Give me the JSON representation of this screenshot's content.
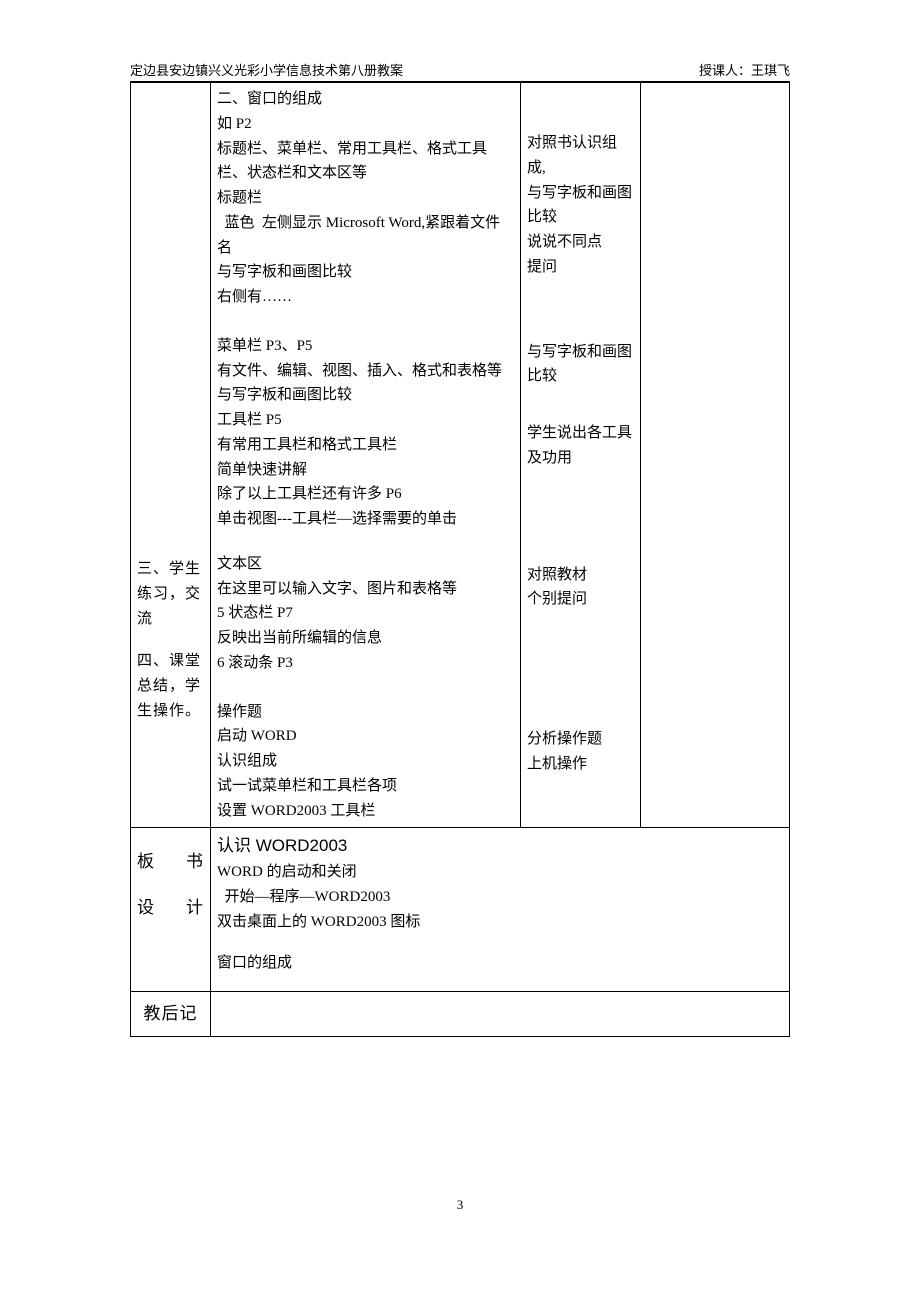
{
  "header": {
    "left": "定边县安边镇兴义光彩小学信息技术第八册教案",
    "right": "授课人：王琪飞"
  },
  "row1": {
    "col1_a": "三、学生练习，交流",
    "col1_b": "四、课堂总结，学生操作。",
    "col2_block1_l1": "二、窗口的组成",
    "col2_block1_l2": "如 P2",
    "col2_block1_l3": "标题栏、菜单栏、常用工具栏、格式工具栏、状态栏和文本区等",
    "col2_block1_l4": "标题栏",
    "col2_block1_l5": "  蓝色  左侧显示 Microsoft Word,紧跟着文件名",
    "col2_block1_l6": "与写字板和画图比较",
    "col2_block1_l7": "右侧有……",
    "col2_block2_l1": "菜单栏    P3、P5",
    "col2_block2_l2": "有文件、编辑、视图、插入、格式和表格等",
    "col2_block2_l3": "与写字板和画图比较",
    "col2_block2_l4": "工具栏    P5",
    "col2_block2_l5": "有常用工具栏和格式工具栏",
    "col2_block2_l6": "简单快速讲解",
    "col2_block2_l7": "除了以上工具栏还有许多 P6",
    "col2_block2_l8": "单击视图---工具栏—选择需要的单击",
    "col2_block3_l1": "文本区",
    "col2_block3_l2": "在这里可以输入文字、图片和表格等",
    "col2_block3_l3": "5 状态栏    P7",
    "col2_block3_l4": "反映出当前所编辑的信息",
    "col2_block3_l5": "6 滚动条      P3",
    "col2_block4_l1": "操作题",
    "col2_block4_l2": "启动 WORD",
    "col2_block4_l3": "认识组成",
    "col2_block4_l4": "试一试菜单栏和工具栏各项",
    "col2_block4_l5": "设置 WORD2003 工具栏",
    "col3_block1_l1": "对照书认识组成,",
    "col3_block1_l2": "与写字板和画图比较",
    "col3_block1_l3": "说说不同点",
    "col3_block1_l4": "提问",
    "col3_block2_l1": "与写字板和画图比较",
    "col3_block2_l2": "学生说出各工具及功用",
    "col3_block3_l1": "对照教材",
    "col3_block3_l2": "个别提问",
    "col3_block4_l1": "分析操作题",
    "col3_block4_l2": "上机操作"
  },
  "row2": {
    "label_a": "板",
    "label_b": "书",
    "label_c": "设",
    "label_d": "计",
    "title": "认识 WORD2003",
    "l1": "WORD 的启动和关闭",
    "l2": "  开始—程序—WORD2003",
    "l3": "双击桌面上的 WORD2003 图标",
    "l4": "窗口的组成"
  },
  "row3": {
    "label": "教后记"
  },
  "footer": {
    "page": "3"
  }
}
